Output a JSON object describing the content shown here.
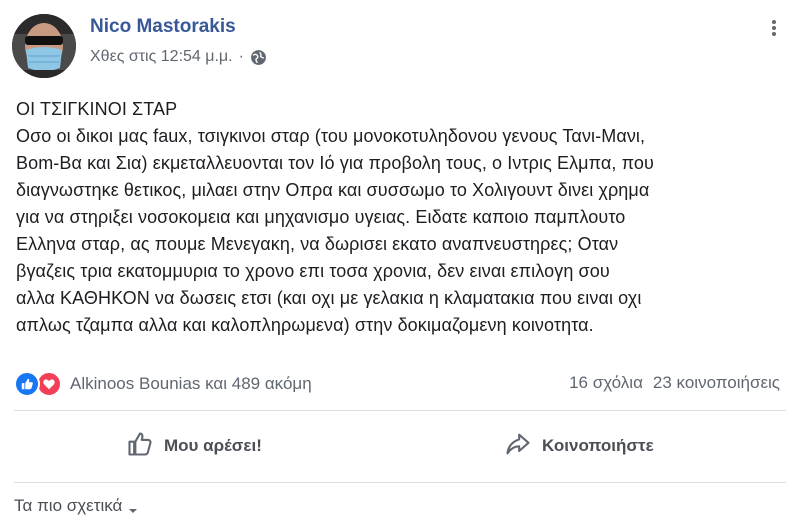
{
  "post": {
    "author": "Nico Mastorakis",
    "timestamp": "Χθες στις 12:54 μ.μ.",
    "separator": "·",
    "privacy_icon": "globe-icon",
    "more_icon": "more-options-icon",
    "text": "ΟΙ ΤΣΙΓΚΙΝΟΙ ΣΤΑΡ\nΟσο οι δικοι μας faux, τσιγκινοι σταρ (του μονοκοτυληδονου γενους Τανι-Μανι,\nBom-Βα και Σια) εκμεταλλευονται τον Ιό για προβολη τους, ο Ιντρις Ελμπα, που\nδιαγνωστηκε θετικος, μιλαει στην Οπρα και συσσωμο το Χολιγουντ δινει χρημα\nγια να στηριξει νοσοκομεια και μηχανισμο υγειας. Ειδατε καποιο παμπλουτο\nΕλληνα σταρ, ας πουμε Μενεγακη, να δωρισει εκατο αναπνευστηρες; Οταν\nβγαζεις τρια εκατομμυρια το χρονο επι τοσα χρονια, δεν ειναι επιλογη σου\nαλλα ΚΑΘΗΚΟΝ να δωσεις ετσι (και οχι με γελακια η κλαματακια που ειναι οχι\nαπλως τζαμπα αλλα και καλοπληρωμενα) στην δοκιμαζομενη κοινοτητα."
  },
  "reactions": {
    "names": "Alkinoos Bounias και 489 ακόμη",
    "icons": [
      "like-icon",
      "love-icon"
    ],
    "like_color": "#1877f2",
    "love_color": "#f33e58"
  },
  "counts": {
    "comments": "16 σχόλια",
    "shares": "23 κοινοποιήσεις"
  },
  "actions": {
    "like_label": "Μου αρέσει!",
    "share_label": "Κοινοποιήστε"
  },
  "sort": {
    "label": "Τα πιο σχετικά"
  },
  "colors": {
    "author": "#385898",
    "secondary_text": "#616770",
    "body_text": "#1c1e21"
  }
}
